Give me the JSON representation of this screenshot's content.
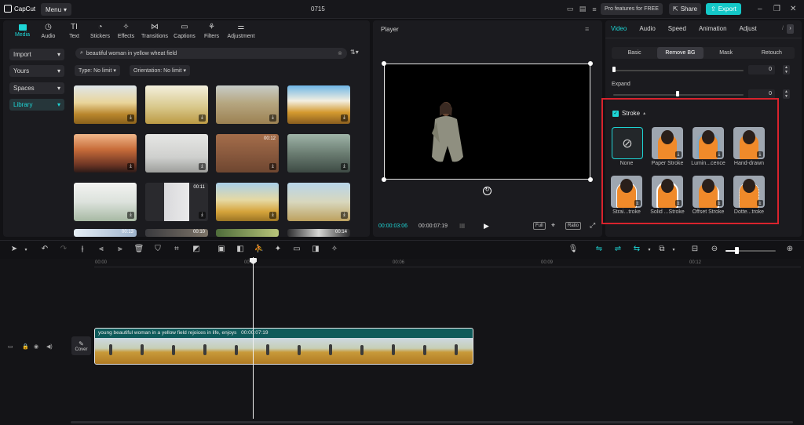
{
  "app": {
    "logo_text": "CapCut",
    "menu_label": "Menu",
    "project_title": "0715",
    "pro_label": "Pro features for FREE",
    "share_label": "Share",
    "export_label": "Export"
  },
  "media_tabs": [
    {
      "label": "Media",
      "icon": "media-icon"
    },
    {
      "label": "Audio",
      "icon": "audio-icon"
    },
    {
      "label": "Text",
      "icon": "text-icon"
    },
    {
      "label": "Stickers",
      "icon": "stickers-icon"
    },
    {
      "label": "Effects",
      "icon": "effects-icon"
    },
    {
      "label": "Transitions",
      "icon": "transitions-icon"
    },
    {
      "label": "Captions",
      "icon": "captions-icon"
    },
    {
      "label": "Filters",
      "icon": "filters-icon"
    },
    {
      "label": "Adjustment",
      "icon": "adjustment-icon"
    }
  ],
  "sidebar": {
    "items": [
      {
        "label": "Import"
      },
      {
        "label": "Yours"
      },
      {
        "label": "Spaces"
      },
      {
        "label": "Library"
      }
    ]
  },
  "search": {
    "value": "beautiful woman in yellow wheat field"
  },
  "filters": {
    "type": "Type: No limit",
    "orientation": "Orientation: No limit"
  },
  "thumbs": [
    {
      "duration": ""
    },
    {
      "duration": ""
    },
    {
      "duration": ""
    },
    {
      "duration": ""
    },
    {
      "duration": ""
    },
    {
      "duration": ""
    },
    {
      "duration": "00:12"
    },
    {
      "duration": ""
    },
    {
      "duration": ""
    },
    {
      "duration": "00:11"
    },
    {
      "duration": ""
    },
    {
      "duration": ""
    },
    {
      "duration": "00:13"
    },
    {
      "duration": "00:10"
    },
    {
      "duration": ""
    },
    {
      "duration": "00:14"
    }
  ],
  "player": {
    "title": "Player",
    "current_time": "00:00:03:06",
    "total_time": "00:00:07:19",
    "full_label": "Full",
    "ratio_label": "Ratio"
  },
  "props": {
    "tabs": [
      "Video",
      "Audio",
      "Speed",
      "Animation",
      "Adjust"
    ],
    "sub_tabs": [
      "Basic",
      "Remove BG",
      "Mask",
      "Retouch"
    ],
    "slider1_value": "0",
    "expand_label": "Expand",
    "expand_value": "0",
    "stroke_label": "Stroke",
    "strokes": [
      {
        "label": "None"
      },
      {
        "label": "Paper Stroke"
      },
      {
        "label": "Lumin...cence"
      },
      {
        "label": "Hand-drawn"
      },
      {
        "label": "Strai...troke"
      },
      {
        "label": "Solid ...Stroke"
      },
      {
        "label": "Offset Stroke"
      },
      {
        "label": "Dotte...troke"
      }
    ]
  },
  "timeline": {
    "ruler": [
      "00:00",
      "00:03",
      "00:06",
      "00:09",
      "00:12"
    ],
    "clip_title": "young beautiful woman in a yellow field rejoices in life, enjoys",
    "clip_duration": "00:00:07:19",
    "cover_label": "Cover"
  },
  "colors": {
    "accent": "#1ed6d6",
    "highlight_box": "#d9232d",
    "export": "#14c8c8"
  }
}
